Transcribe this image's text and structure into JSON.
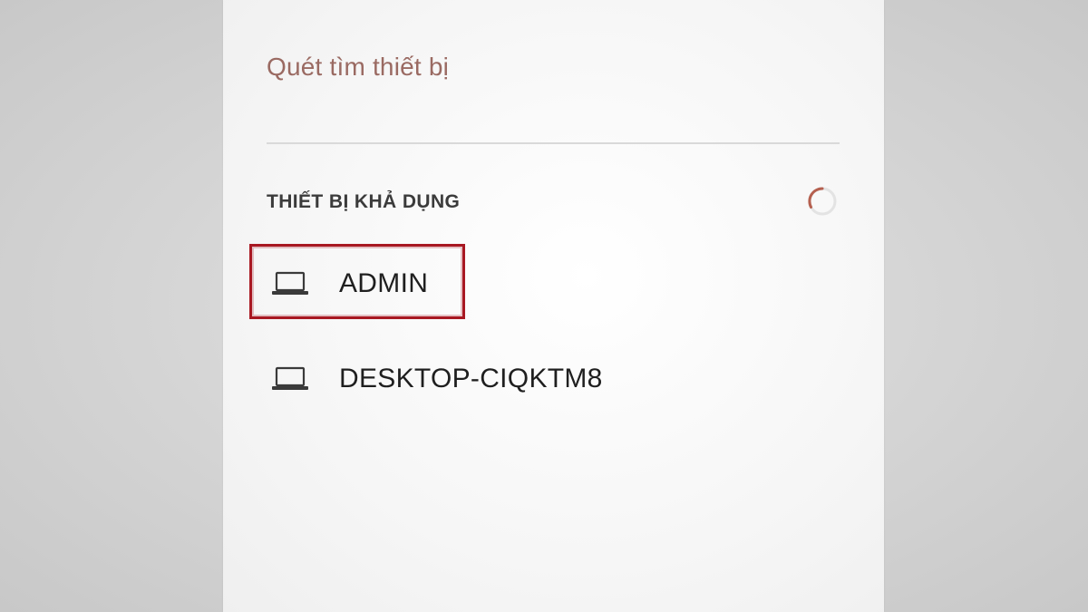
{
  "dialog": {
    "title": "Quét tìm thiết bị",
    "section_header": "THIẾT BỊ KHẢ DỤNG",
    "spinner_icon": "loading-spinner-icon",
    "devices": [
      {
        "name": "ADMIN",
        "icon": "laptop-icon",
        "highlighted": true
      },
      {
        "name": "DESKTOP-CIQKTM8",
        "icon": "laptop-icon",
        "highlighted": false
      }
    ]
  },
  "colors": {
    "title": "#9a6a62",
    "highlight_border": "#a81822",
    "spinner_accent": "#b5604f"
  }
}
